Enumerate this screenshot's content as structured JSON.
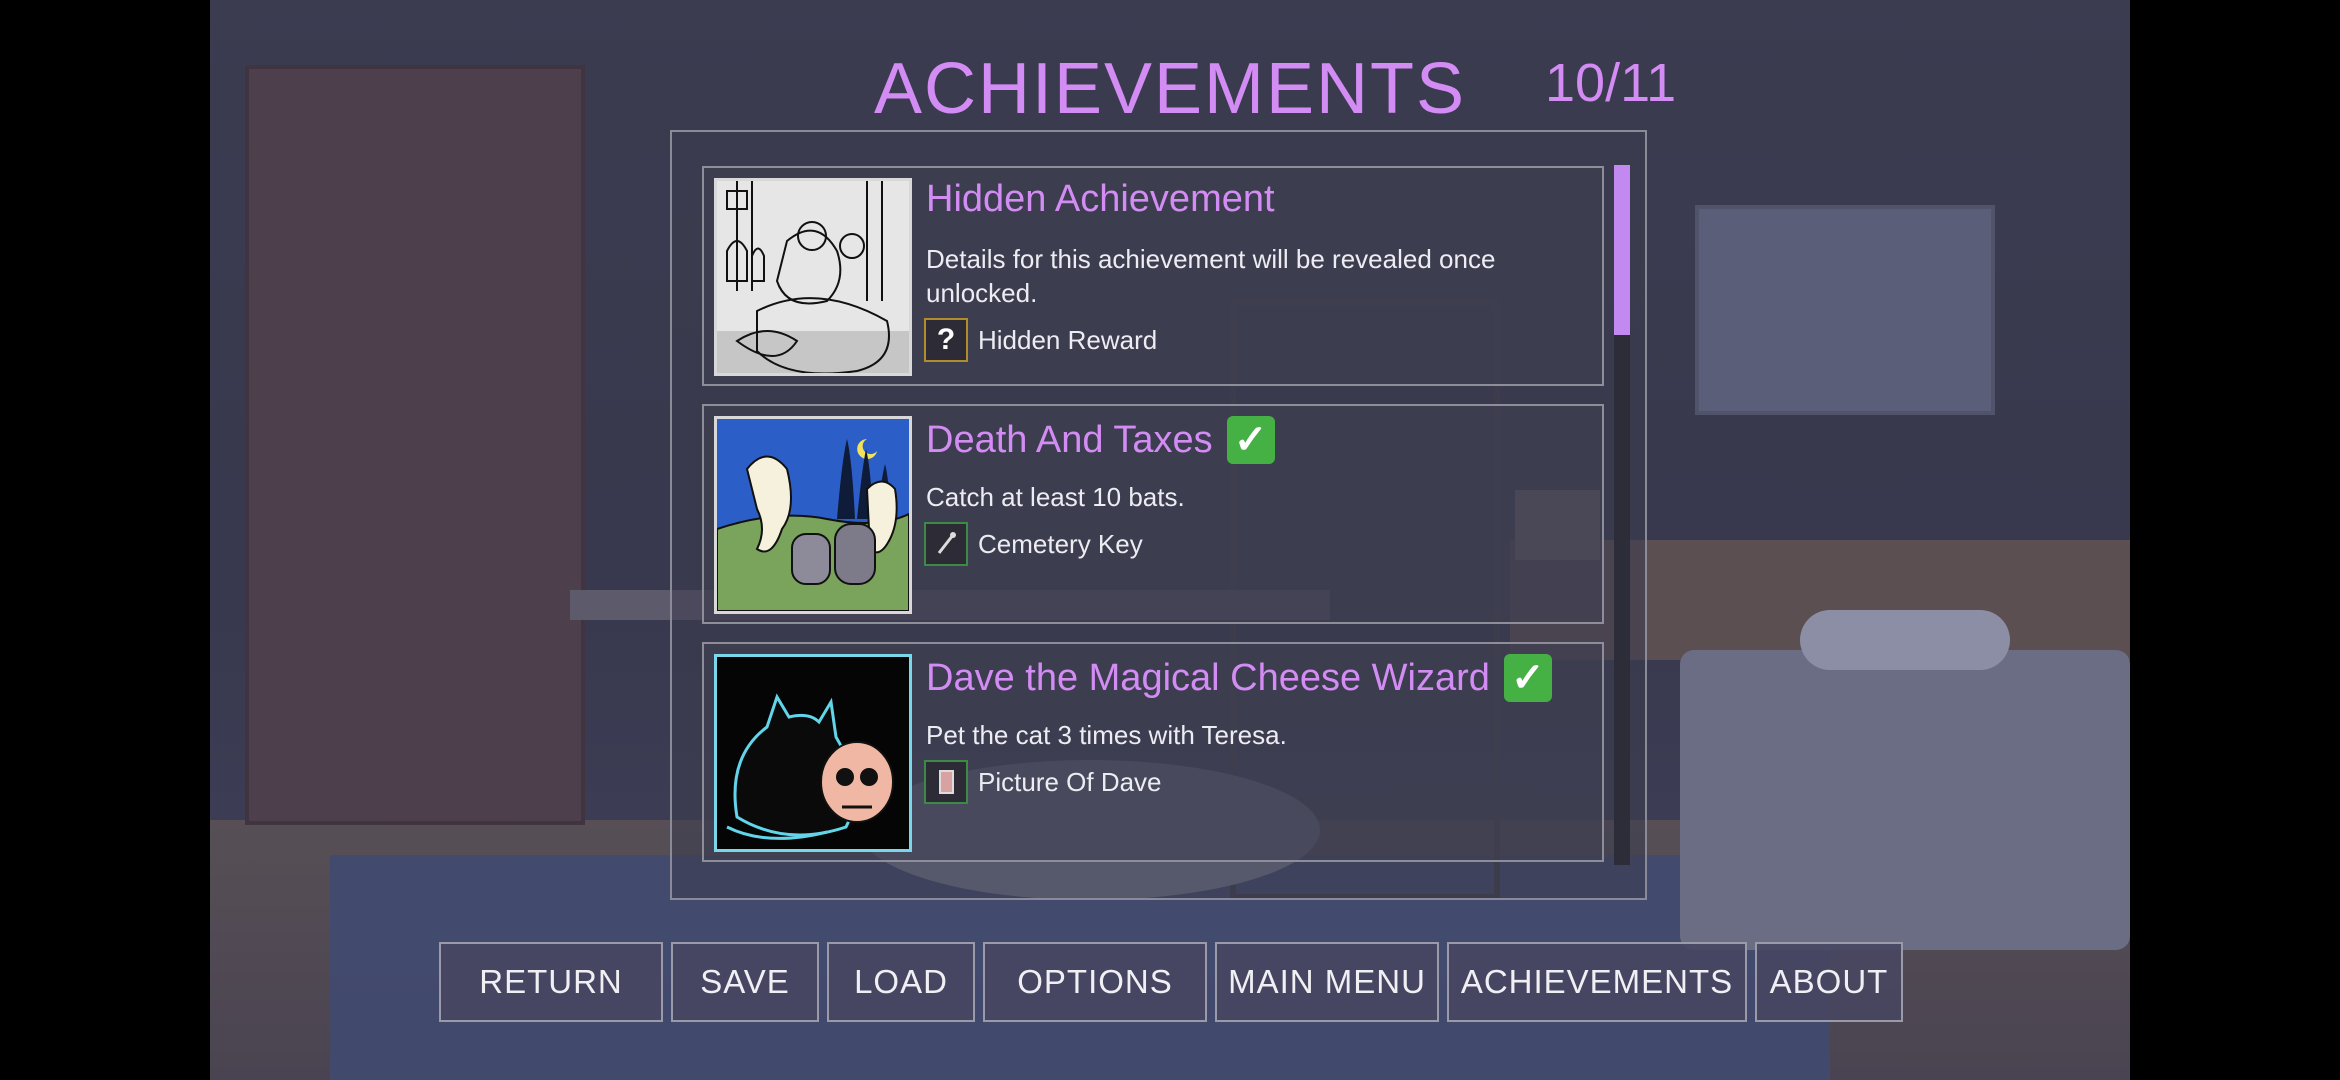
{
  "screen": {
    "title": "ACHIEVEMENTS",
    "progress_text": "10/11"
  },
  "achievements": [
    {
      "title": "Hidden Achievement",
      "description": "Details for this achievement will be revealed once unlocked.",
      "reward": "Hidden Reward",
      "reward_icon": "question-mark-icon",
      "reward_icon_glyph": "?",
      "unlocked": false,
      "image": "tarot-scene-image"
    },
    {
      "title": "Death And Taxes",
      "description": "Catch at least 10 bats.",
      "reward": "Cemetery Key",
      "reward_icon": "key-icon",
      "unlocked": true,
      "image": "ghosts-cemetery-image"
    },
    {
      "title": "Dave the Magical Cheese Wizard",
      "description": "Pet the cat 3 times with Teresa.",
      "reward": "Picture Of Dave",
      "reward_icon": "photo-card-icon",
      "unlocked": true,
      "image": "cat-skull-image"
    }
  ],
  "check_glyph": "✓",
  "menu": {
    "return": "RETURN",
    "save": "SAVE",
    "load": "LOAD",
    "options": "OPTIONS",
    "main_menu": "MAIN MENU",
    "achievements": "ACHIEVEMENTS",
    "about": "ABOUT"
  },
  "colors": {
    "accent": "#d38cf3",
    "check": "#45b044",
    "scrollbar": "#c28af0"
  }
}
